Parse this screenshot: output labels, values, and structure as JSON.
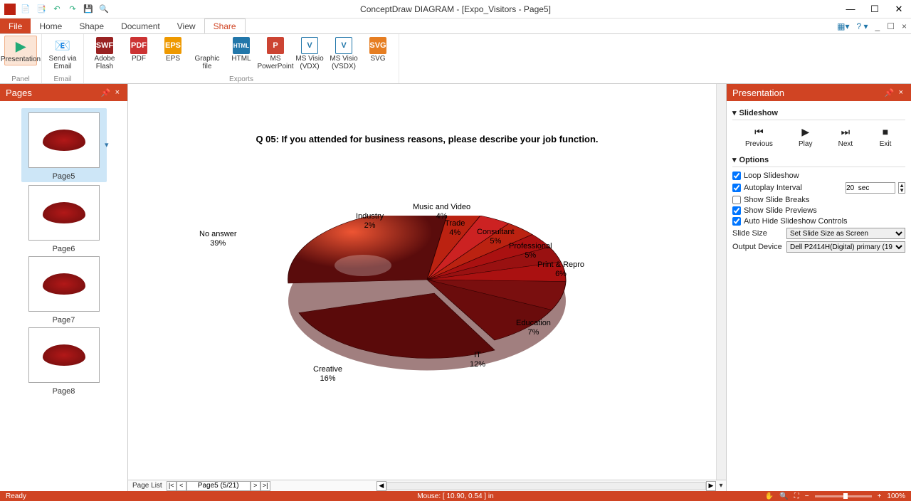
{
  "app": {
    "title": "ConceptDraw DIAGRAM - [Expo_Visitors - Page5]"
  },
  "ribbon_tabs": {
    "file": "File",
    "home": "Home",
    "shape": "Shape",
    "document": "Document",
    "view": "View",
    "share": "Share"
  },
  "ribbon": {
    "presentation": "Presentation",
    "send_email": "Send via\nEmail",
    "adobe_flash": "Adobe\nFlash",
    "pdf": "PDF",
    "eps": "EPS",
    "graphic_file": "Graphic\nfile",
    "html": "HTML",
    "ms_powerpoint": "MS\nPowerPoint",
    "ms_visio_vdx": "MS Visio\n(VDX)",
    "ms_visio_vsdx": "MS Visio\n(VSDX)",
    "svg": "SVG",
    "group_panel": "Panel",
    "group_email": "Email",
    "group_exports": "Exports"
  },
  "pages_panel": {
    "title": "Pages",
    "items": [
      "Page5",
      "Page6",
      "Page7",
      "Page8"
    ]
  },
  "chart_data": {
    "type": "pie",
    "title": "Q 05: If you attended for business reasons, please describe your job function.",
    "series": [
      {
        "name": "No answer",
        "value": 39
      },
      {
        "name": "Creative",
        "value": 16
      },
      {
        "name": "IT",
        "value": 12
      },
      {
        "name": "Education",
        "value": 7
      },
      {
        "name": "Print & Repro",
        "value": 6
      },
      {
        "name": "Professional",
        "value": 5
      },
      {
        "name": "Consultant",
        "value": 5
      },
      {
        "name": "Trade",
        "value": 4
      },
      {
        "name": "Music and Video",
        "value": 4
      },
      {
        "name": "Industry",
        "value": 2
      }
    ]
  },
  "page_nav": {
    "label": "Page List",
    "current": "Page5 (5/21)"
  },
  "presentation_panel": {
    "title": "Presentation",
    "slideshow_h": "Slideshow",
    "previous": "Previous",
    "play": "Play",
    "next": "Next",
    "exit": "Exit",
    "options_h": "Options",
    "loop": "Loop Slideshow",
    "autoplay": "Autoplay Interval",
    "autoplay_val": "20  sec",
    "breaks": "Show Slide Breaks",
    "previews": "Show Slide Previews",
    "autohide": "Auto Hide Slideshow Controls",
    "slide_size": "Slide Size",
    "slide_size_val": "Set Slide Size as Screen",
    "output_device": "Output Device",
    "output_device_val": "Dell P2414H(Digital) primary (19"
  },
  "status": {
    "ready": "Ready",
    "mouse": "Mouse: [ 10.90, 0.54 ] in",
    "zoom": "100%"
  }
}
